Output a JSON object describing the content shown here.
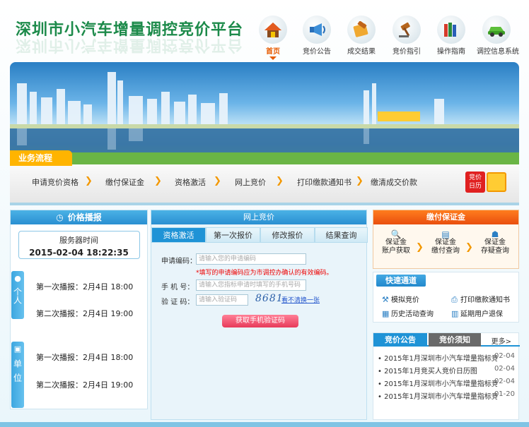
{
  "header": {
    "title": "深圳市小汽车增量调控竞价平台",
    "nav": [
      {
        "label": "首页",
        "icon": "home-icon",
        "active": true
      },
      {
        "label": "竞价公告",
        "icon": "megaphone-icon"
      },
      {
        "label": "成交结果",
        "icon": "gavel-icon"
      },
      {
        "label": "竞价指引",
        "icon": "hammer-icon"
      },
      {
        "label": "操作指南",
        "icon": "books-icon"
      },
      {
        "label": "调控信息系统",
        "icon": "car-icon"
      }
    ]
  },
  "process": {
    "label": "业务流程",
    "steps": [
      "申请竞价资格",
      "缴付保证金",
      "资格激活",
      "网上竞价",
      "打印缴款通知书",
      "缴清成交价款"
    ],
    "calendar": {
      "line1": "竞价",
      "line2": "日历"
    }
  },
  "price_broadcast": {
    "title": "价格播报",
    "server_time_label": "服务器时间",
    "server_time": "2015-02-04 18:22:35",
    "personal_tab": "个人",
    "company_tab": "单位",
    "personal": [
      "第一次播报：2月4日 18:00",
      "第二次播报：2月4日 19:00"
    ],
    "company": [
      "第一次播报：2月4日 18:00",
      "第二次播报：2月4日 19:00"
    ]
  },
  "online_bid": {
    "title": "网上竞价",
    "tabs": [
      "资格激活",
      "第一次报价",
      "修改报价",
      "结果查询"
    ],
    "fields": {
      "apply_label": "申请编码：",
      "apply_placeholder": "请输入您的申请编码",
      "hint": "*填写的申请编码应为市调控办确认的有效编码。",
      "phone_label": "手 机 号：",
      "phone_placeholder": "请输入您指标申请时填写的手机号码",
      "code_label": "验 证 码：",
      "code_placeholder": "请输入验证码",
      "captcha": "8681",
      "switch": "看不清换一张",
      "button": "获取手机验证码"
    }
  },
  "deposit": {
    "title": "缴付保证金",
    "items": [
      {
        "line1": "保证金",
        "line2": "账户获取"
      },
      {
        "line1": "保证金",
        "line2": "缴付查询"
      },
      {
        "line1": "保证金",
        "line2": "存疑查询"
      }
    ]
  },
  "quick": {
    "title": "快速通道",
    "links": [
      "模拟竞价",
      "打印缴款通知书",
      "历史活动查询",
      "延期用户退保"
    ]
  },
  "notices": {
    "tab1": "竞价公告",
    "tab2": "竞价须知",
    "more": "更多>",
    "items": [
      {
        "title": "2015年1月深圳市小汽车增量指标竞价情",
        "date": "02-04"
      },
      {
        "title": "2015年1月竞买人竞价日历图",
        "date": "02-04"
      },
      {
        "title": "2015年1月深圳市小汽车增量指标竞价公",
        "date": "02-04"
      },
      {
        "title": "2015年1月深圳市小汽车增量指标竞价公",
        "date": "01-20"
      }
    ]
  },
  "colors": {
    "brand_green": "#1c8a4a",
    "accent_orange": "#f39800",
    "blue": "#1f93d6"
  }
}
